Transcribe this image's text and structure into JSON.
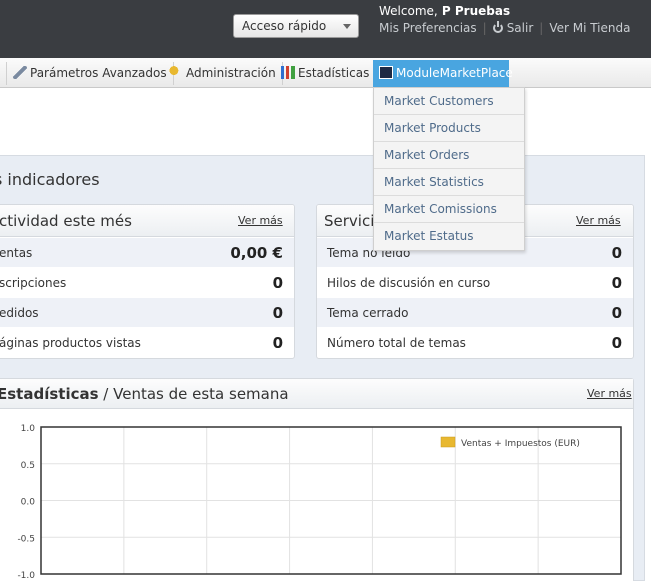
{
  "header": {
    "quick_access": "Acceso rápido",
    "welcome_prefix": "Welcome,",
    "user_name": "P Pruebas",
    "preferences": "Mis Preferencias",
    "logout": "Salir",
    "view_store": "Ver Mi Tienda"
  },
  "nav": {
    "items": [
      {
        "label": "Parámetros Avanzados",
        "icon": "wrench-icon"
      },
      {
        "label": "Administración",
        "icon": "key-icon"
      },
      {
        "label": "Estadísticas",
        "icon": "bar-chart-icon"
      },
      {
        "label": "ModuleMarketPlace",
        "icon": "module-icon"
      }
    ]
  },
  "dropdown": {
    "items": [
      "Market Customers",
      "Market Products",
      "Market Orders",
      "Market Statistics",
      "Market Comissions",
      "Market Estatus"
    ]
  },
  "dashboard": {
    "title": "s indicadores",
    "activity": {
      "title": "ctividad este més",
      "more": "Ver más",
      "rows": [
        {
          "label": "entas",
          "value": "0,00 €"
        },
        {
          "label": "scripciones",
          "value": "0"
        },
        {
          "label": "edidos",
          "value": "0"
        },
        {
          "label": "áginas productos vistas",
          "value": "0"
        }
      ]
    },
    "service": {
      "title": "Servicio",
      "more": "Ver más",
      "rows": [
        {
          "label": "Tema no leído",
          "value": "0"
        },
        {
          "label": "Hilos de discusión en curso",
          "value": "0"
        },
        {
          "label": "Tema cerrado",
          "value": "0"
        },
        {
          "label": "Número total de temas",
          "value": "0"
        }
      ]
    },
    "stats": {
      "title_bold": "Estadísticas",
      "title_rest": " / Ventas de esta semana",
      "more": "Ver más"
    }
  },
  "colors": {
    "header_bg": "#3a3d41",
    "nav_active": "#49a5e0",
    "legend_swatch": "#e8b830"
  },
  "chart_data": {
    "type": "line",
    "title": "",
    "xlabel": "",
    "ylabel": "",
    "ylim": [
      -1.0,
      1.0
    ],
    "yticks": [
      "1.0",
      "0.5",
      "0.0",
      "-0.5",
      "-1.0"
    ],
    "grid": true,
    "legend_position": "top-right",
    "series": [
      {
        "name": "Ventas + Impuestos (EUR)",
        "values": []
      }
    ]
  }
}
